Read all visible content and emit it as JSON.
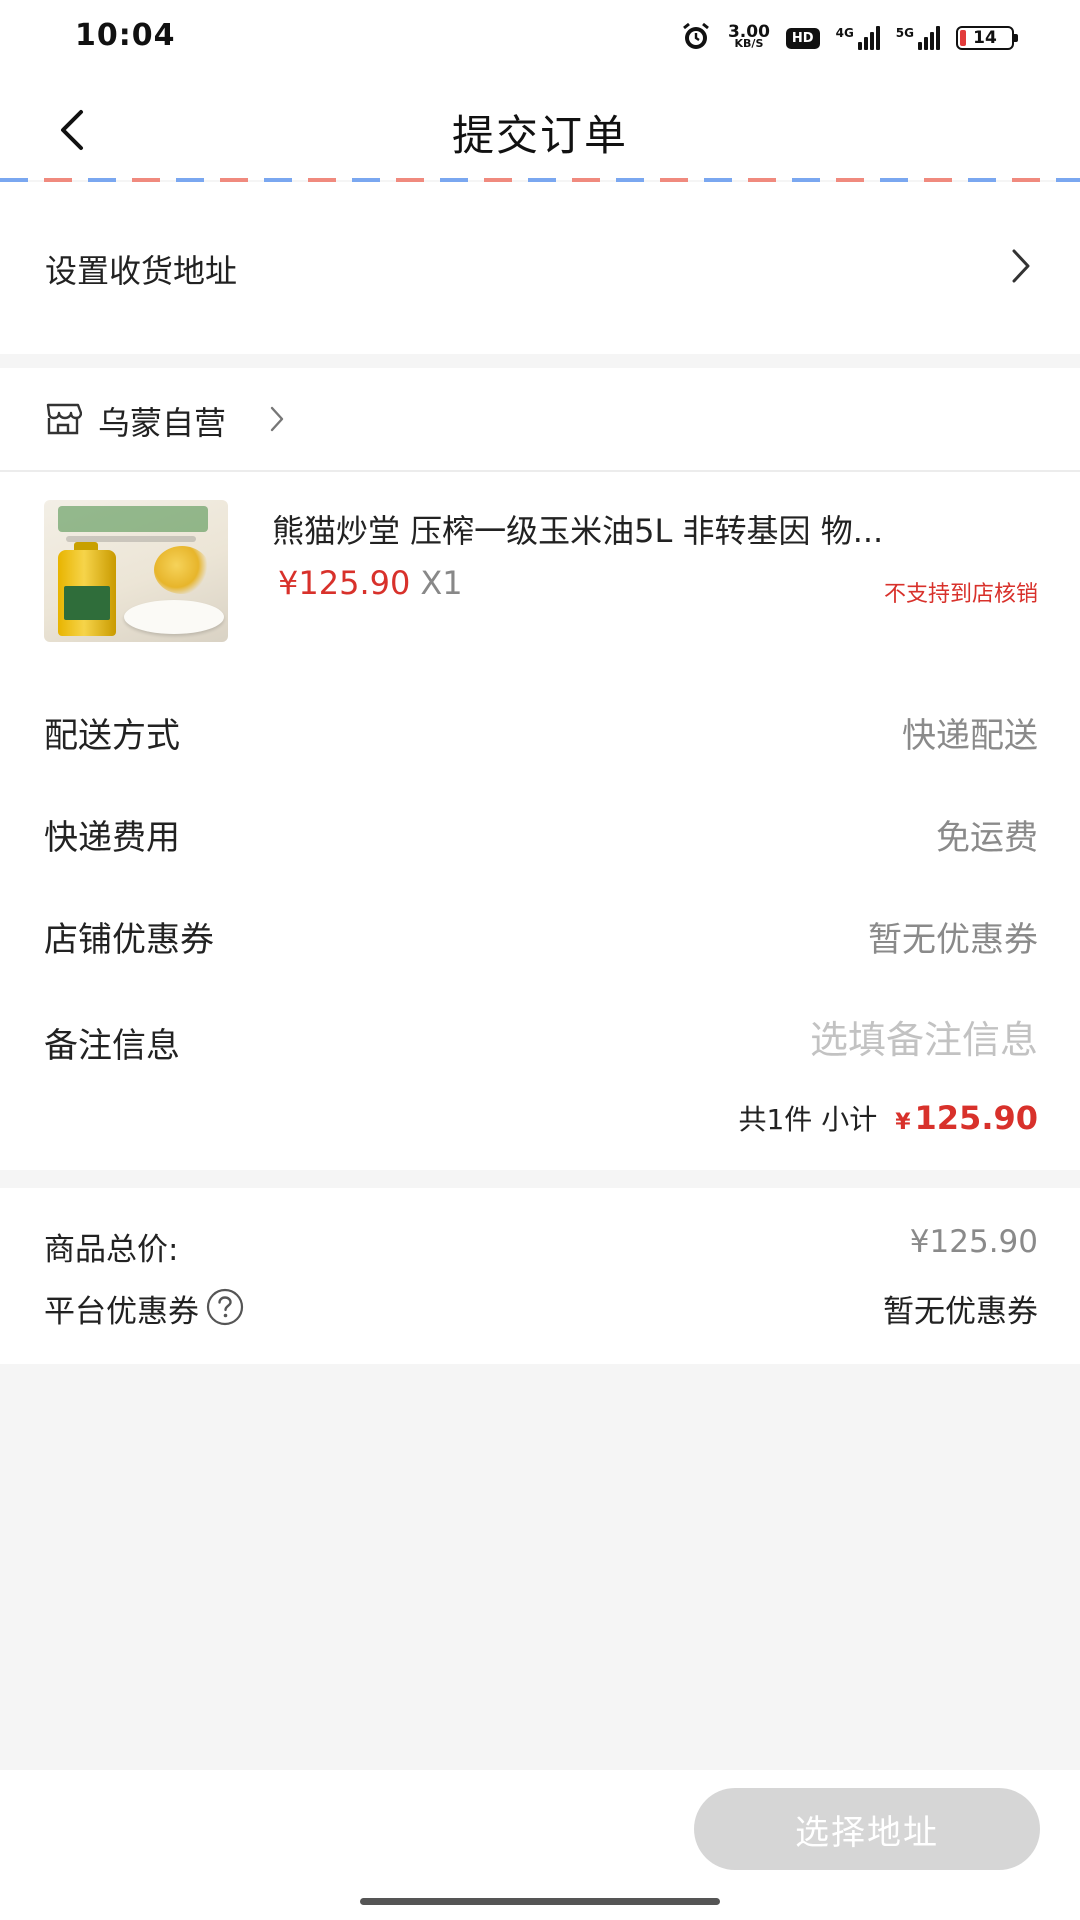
{
  "status_bar": {
    "time": "10:04",
    "speed_value": "3.00",
    "speed_unit": "KB/S",
    "hd": "HD",
    "net1": "4G",
    "net2": "5G",
    "battery": "14",
    "icons": [
      "alarm-icon",
      "hd-icon",
      "signal-4g-icon",
      "signal-5g-icon",
      "battery-icon"
    ]
  },
  "nav": {
    "title": "提交订单",
    "back_icon": "chevron-left-icon"
  },
  "address": {
    "label": "设置收货地址",
    "chevron_icon": "chevron-right-icon"
  },
  "store": {
    "name": "乌蒙自营",
    "icon": "store-icon"
  },
  "goods": {
    "title": "熊猫炒堂 压榨一级玉米油5L 非转基因 物...",
    "price": "¥125.90",
    "quantity": "X1",
    "note": "不支持到店核销"
  },
  "rows": {
    "delivery": {
      "label": "配送方式",
      "value": "快递配送"
    },
    "shipping_fee": {
      "label": "快递费用",
      "value": "免运费"
    },
    "store_coupon": {
      "label": "店铺优惠券",
      "value": "暂无优惠券"
    },
    "remark": {
      "label": "备注信息",
      "placeholder": "选填备注信息",
      "value": ""
    }
  },
  "subtotal": {
    "count_text": "共1件 小计",
    "currency": "¥",
    "amount": "125.90"
  },
  "totals": {
    "goods_total_label": "商品总价:",
    "goods_total_value": "¥125.90",
    "platform_coupon_label": "平台优惠券",
    "platform_coupon_value": "暂无优惠券"
  },
  "bottom": {
    "button_label": "选择地址"
  },
  "colors": {
    "price_red": "#d8312b",
    "button_disabled": "#d6d6d6",
    "page_bg": "#f5f5f5"
  }
}
